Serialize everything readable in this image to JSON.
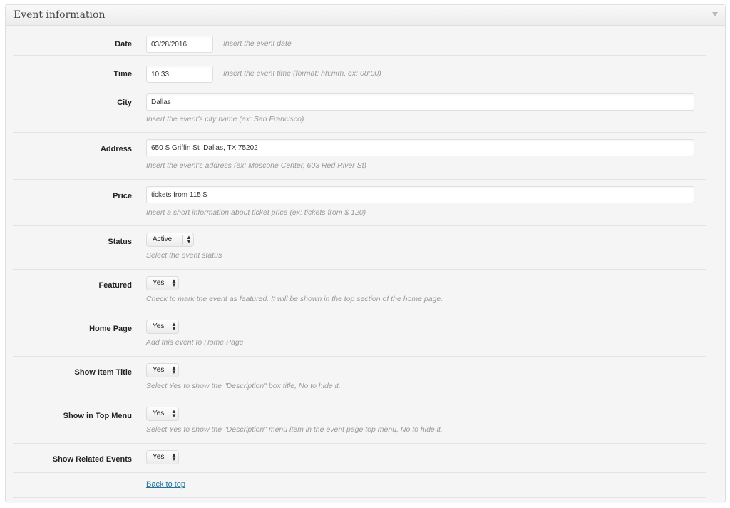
{
  "panel": {
    "title": "Event information",
    "toggle_icon": "triangle-down-icon"
  },
  "fields": {
    "date": {
      "label": "Date",
      "value": "03/28/2016",
      "hint": "Insert the event date"
    },
    "time": {
      "label": "Time",
      "value": "10:33",
      "hint": "Insert the event time (format: hh:mm, ex: 08:00)"
    },
    "city": {
      "label": "City",
      "value": "Dallas",
      "hint": "Insert the event's city name (ex: San Francisco)"
    },
    "address": {
      "label": "Address",
      "value": "650 S Griffin St  Dallas, TX 75202",
      "hint": "Insert the event's address (ex: Moscone Center, 603 Red River St)"
    },
    "price": {
      "label": "Price",
      "value": "tickets from 115 $",
      "hint": "Insert a short information about ticket price (ex: tickets from $ 120)"
    },
    "status": {
      "label": "Status",
      "value": "Active",
      "hint": "Select the event status"
    },
    "featured": {
      "label": "Featured",
      "value": "Yes",
      "hint": "Check to mark the event as featured. It will be shown in the top section of the home page."
    },
    "home_page": {
      "label": "Home Page",
      "value": "Yes",
      "hint": "Add this event to Home Page"
    },
    "show_item_title": {
      "label": "Show Item Title",
      "value": "Yes",
      "hint": "Select Yes to show the \"Description\" box title, No to hide it."
    },
    "show_in_top_menu": {
      "label": "Show in Top Menu",
      "value": "Yes",
      "hint": "Select Yes to show the \"Description\" menu item in the event page top menu, No to hide it."
    },
    "show_related_events": {
      "label": "Show Related Events",
      "value": "Yes"
    }
  },
  "footer": {
    "back_to_top": "Back to top"
  },
  "colors": {
    "link": "#21759b",
    "hint": "#999999",
    "panel_bg": "#f5f5f5"
  }
}
